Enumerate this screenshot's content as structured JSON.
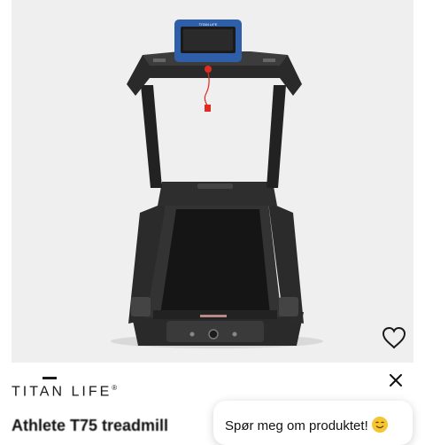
{
  "product": {
    "image_alt": "Treadmill product photo",
    "favorite_icon": "heart-outline-icon"
  },
  "brand": {
    "name": "TITAN LIFE",
    "trademark": "®"
  },
  "title": "Athlete T75 treadmill",
  "popup": {
    "close_icon": "close-icon",
    "message": "Spør meg om produktet!",
    "emoji": "smiling-face-icon"
  },
  "colors": {
    "image_background": "#efefef",
    "console_blue": "#2f5fa8",
    "safety_key_red": "#e02b20"
  }
}
